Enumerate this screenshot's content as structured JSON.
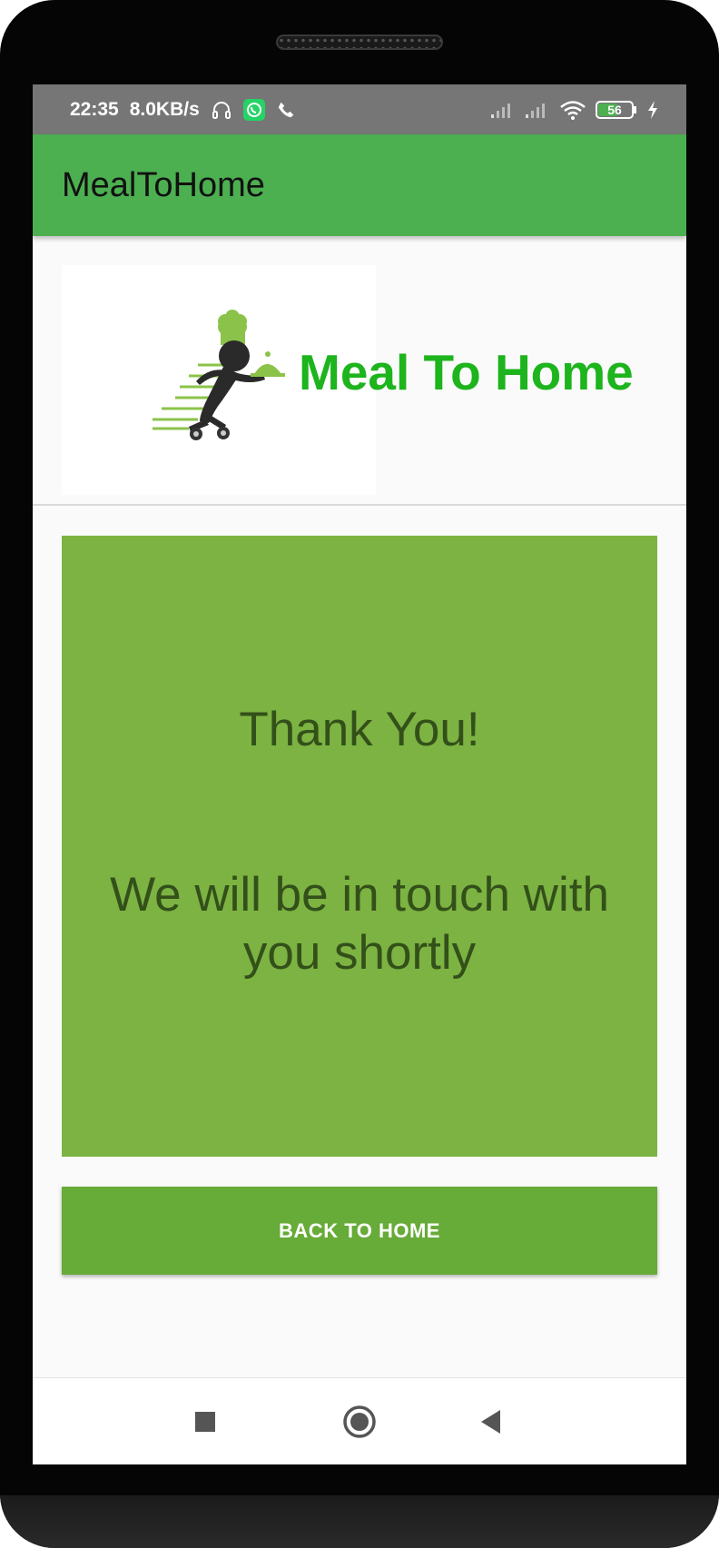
{
  "status_bar": {
    "time": "22:35",
    "speed": "8.0KB/s",
    "battery": "56",
    "icons": [
      "headphones-icon",
      "whatsapp-icon",
      "phone-icon",
      "signal-icon",
      "signal-icon",
      "wifi-icon",
      "battery-icon",
      "charging-icon"
    ]
  },
  "app_bar": {
    "title": "MealToHome"
  },
  "banner": {
    "brand_text": "Meal To Home",
    "logo": "chef-delivery-logo"
  },
  "card": {
    "thanks": "Thank You!",
    "message": "We will be in touch with you shortly"
  },
  "back_button": {
    "label": "BACK TO HOME"
  },
  "nav_bar": {
    "buttons": [
      "recents",
      "home",
      "back"
    ]
  },
  "colors": {
    "app_bar": "#4caf50",
    "brand_text": "#1db41d",
    "card": "#7cb342",
    "card_text": "#33501a",
    "button": "#67ab38"
  }
}
